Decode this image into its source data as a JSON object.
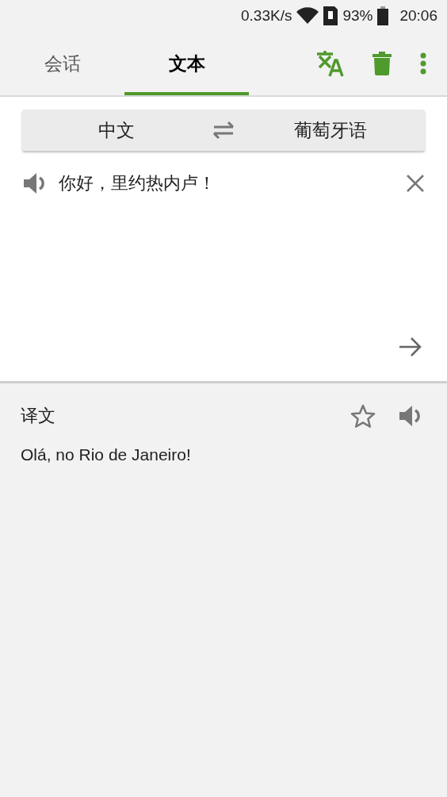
{
  "status_bar": {
    "speed": "0.33K/s",
    "battery": "93%",
    "time": "20:06"
  },
  "tabs": [
    {
      "label": "会话",
      "selected": false
    },
    {
      "label": "文本",
      "selected": true
    }
  ],
  "languages": {
    "source": "中文",
    "target": "葡萄牙语"
  },
  "input": {
    "value": "你好，里约热内卢！"
  },
  "result": {
    "heading": "译文",
    "starred": false,
    "text": "Olá, no Rio de Janeiro!"
  }
}
